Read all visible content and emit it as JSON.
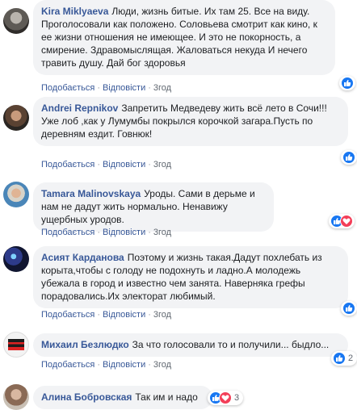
{
  "comments": [
    {
      "author": "Kira Miklyaeva",
      "text": "Люди, жизнь битые. Их там 25. Все на виду. Проголосовали как положено. Соловьева смотрит как кино, к ее жизни отношения не имеющее. И это не покорность, а смирение. Здравомыслящая. Жаловаться некуда И нечего травить душу. Дай бог здоровья",
      "like": "Подобається",
      "reply": "Відповісти",
      "time": "3год",
      "reaction_count": ""
    },
    {
      "author": "Andrei Repnikov",
      "text": "Запретить Медведеву жить всё лето в Сочи!!! Уже лоб ,как у Лумумбы покрылся корочкой загара.Пусть по деревням ездит. Говнюк!",
      "like": "Подобається",
      "reply": "Відповісти",
      "time": "3год",
      "reaction_count": ""
    },
    {
      "author": "Tamara Malinovskaya",
      "text": "Уроды. Сами в дерьме и нам не дадут жить нормально. Ненавижу ущербных уродов.",
      "like": "Подобається",
      "reply": "Відповісти",
      "time": "3год",
      "reaction_count": ""
    },
    {
      "author": "Асият Карданова",
      "text": "Поэтому и жизнь такая.Дадут похлебать из корыта,чтобы с голоду не подохнуть и ладно.А молодежь убежала в город и известно чем занята. Наверняка грефы порадовались.Их электорат любимый.",
      "like": "Подобається",
      "reply": "Відповісти",
      "time": "3год",
      "reaction_count": ""
    },
    {
      "author": "Михаил Безлюдко",
      "text": "За что голосовали то и получили... быдло...",
      "like": "Подобається",
      "reply": "Відповісти",
      "time": "3год",
      "reaction_count": "2"
    },
    {
      "author": "Алина Бобровская",
      "text": "Так им и надо",
      "reaction_count": "3"
    }
  ],
  "colors": {
    "link": "#385898",
    "bubble": "#f2f3f5",
    "like": "#1877f2",
    "love": "#f33e58"
  }
}
